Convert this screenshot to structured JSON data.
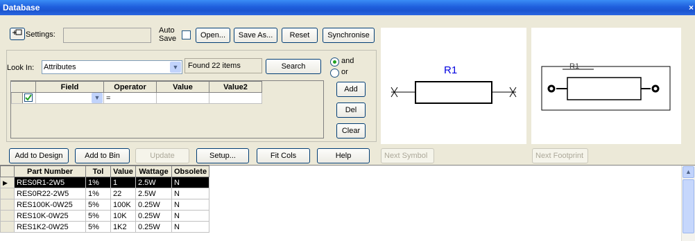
{
  "window": {
    "title": "Database",
    "close_icon": "close-icon"
  },
  "top": {
    "settings_label": "Settings:",
    "settings_value": "",
    "auto_save_label_1": "Auto",
    "auto_save_label_2": "Save",
    "open_label": "Open...",
    "save_as_label": "Save As...",
    "reset_label": "Reset",
    "synchronise_label": "Synchronise"
  },
  "search": {
    "look_in_label": "Look In:",
    "look_in_value": "Attributes",
    "found_text": "Found 22 items",
    "search_label": "Search",
    "and_label": "and",
    "or_label": "or",
    "add_label": "Add",
    "del_label": "Del",
    "clear_label": "Clear"
  },
  "criteria": {
    "headers": [
      "Field",
      "Operator",
      "Value",
      "Value2"
    ],
    "rows": [
      {
        "field": "",
        "operator": "=",
        "value": "",
        "value2": ""
      }
    ]
  },
  "symbol_preview": {
    "ref": "R1"
  },
  "footprint_preview": {
    "ref": "R1"
  },
  "toolbar": {
    "add_to_design": "Add to Design",
    "add_to_bin": "Add to Bin",
    "update": "Update",
    "setup": "Setup...",
    "fit_cols": "Fit Cols",
    "help": "Help",
    "next_symbol": "Next Symbol",
    "next_footprint": "Next Footprint"
  },
  "results": {
    "headers": [
      "Part Number",
      "Tol",
      "Value",
      "Wattage",
      "Obsolete"
    ],
    "rows": [
      {
        "part": "RES0R1-2W5",
        "tol": "1%",
        "value": "1",
        "wattage": "2.5W",
        "obsolete": "N"
      },
      {
        "part": "RES0R22-2W5",
        "tol": "1%",
        "value": "22",
        "wattage": "2.5W",
        "obsolete": "N"
      },
      {
        "part": "RES100K-0W25",
        "tol": "5%",
        "value": "100K",
        "wattage": "0.25W",
        "obsolete": "N"
      },
      {
        "part": "RES10K-0W25",
        "tol": "5%",
        "value": "10K",
        "wattage": "0.25W",
        "obsolete": "N"
      },
      {
        "part": "RES1K2-0W25",
        "tol": "5%",
        "value": "1K2",
        "wattage": "0.25W",
        "obsolete": "N"
      }
    ],
    "selected_row": 0
  }
}
